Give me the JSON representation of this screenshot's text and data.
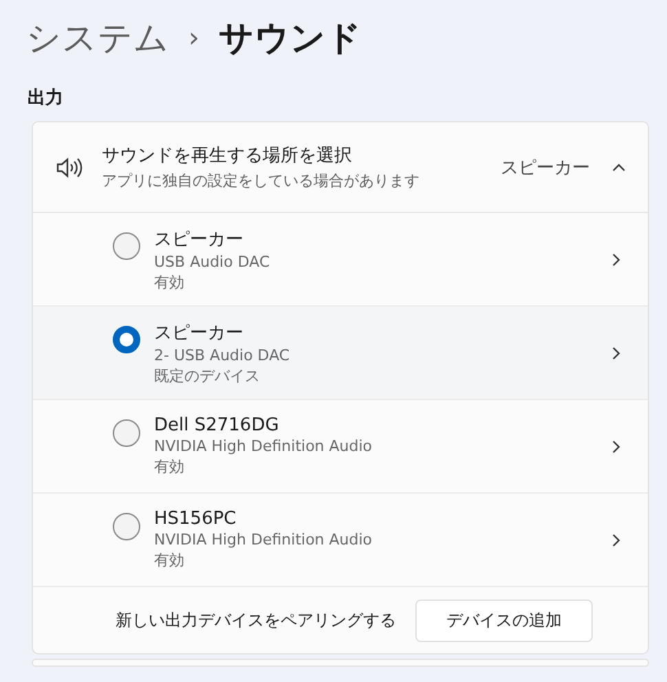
{
  "breadcrumb": {
    "parent": "システム",
    "separator": "›",
    "current": "サウンド"
  },
  "section_title": "出力",
  "output_header": {
    "title": "サウンドを再生する場所を選択",
    "subtitle": "アプリに独自の設定をしている場合があります",
    "value": "スピーカー",
    "expanded": true
  },
  "devices": [
    {
      "name": "スピーカー",
      "driver": "USB Audio DAC",
      "status": "有効",
      "selected": false
    },
    {
      "name": "スピーカー",
      "driver": "2- USB Audio DAC",
      "status": "既定のデバイス",
      "selected": true
    },
    {
      "name": "Dell S2716DG",
      "driver": "NVIDIA High Definition Audio",
      "status": "有効",
      "selected": false
    },
    {
      "name": "HS156PC",
      "driver": "NVIDIA High Definition Audio",
      "status": "有効",
      "selected": false
    }
  ],
  "pair": {
    "label": "新しい出力デバイスをペアリングする",
    "button": "デバイスの追加"
  }
}
